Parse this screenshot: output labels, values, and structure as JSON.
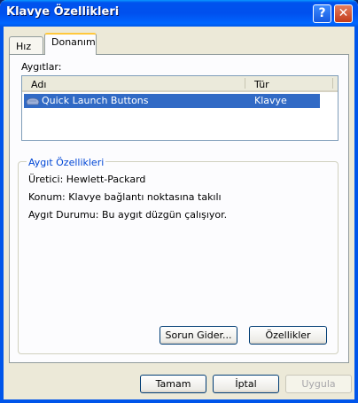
{
  "window": {
    "title": "Klavye Özellikleri",
    "help_glyph": "?",
    "close_glyph": "✕"
  },
  "tabs": [
    {
      "label": "Hız"
    },
    {
      "label": "Donanım"
    }
  ],
  "devices": {
    "label": "Aygıtlar:",
    "columns": [
      "Adı",
      "Tür"
    ],
    "rows": [
      {
        "name": "Quick Launch Buttons",
        "type": "Klavye",
        "icon": "keyboard-icon",
        "selected": true
      }
    ]
  },
  "properties": {
    "title": "Aygıt Özellikleri",
    "manufacturer": "Üretici: Hewlett-Packard",
    "location": "Konum: Klavye bağlantı noktasına takılı",
    "status": "Aygıt Durumu: Bu aygıt düzgün çalışıyor."
  },
  "buttons": {
    "troubleshoot": "Sorun Gider...",
    "properties": "Özellikler",
    "ok": "Tamam",
    "cancel": "İptal",
    "apply": "Uygula"
  },
  "colors": {
    "titlebar": "#0050EE",
    "selection": "#316AC5",
    "group_title": "#0046D5",
    "tab_highlight": "#FFC83C"
  }
}
